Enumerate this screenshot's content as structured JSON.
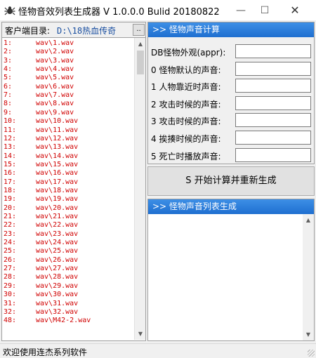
{
  "window": {
    "title": "怪物音效列表生成器 V 1.0.0.0 Bulid 20180822",
    "minimize": "—",
    "maximize": "☐",
    "close": "✕"
  },
  "left": {
    "dir_label": "客户端目录:",
    "dir_value": "D:\\18热血传奇",
    "browse_label": ".."
  },
  "sound_list": [
    {
      "num": "1:",
      "file": "wav\\1.wav"
    },
    {
      "num": "2:",
      "file": "wav\\2.wav"
    },
    {
      "num": "3:",
      "file": "wav\\3.wav"
    },
    {
      "num": "4:",
      "file": "wav\\4.wav"
    },
    {
      "num": "5:",
      "file": "wav\\5.wav"
    },
    {
      "num": "6:",
      "file": "wav\\6.wav"
    },
    {
      "num": "7:",
      "file": "wav\\7.wav"
    },
    {
      "num": "8:",
      "file": "wav\\8.wav"
    },
    {
      "num": "9:",
      "file": "wav\\9.wav"
    },
    {
      "num": "10:",
      "file": "wav\\10.wav"
    },
    {
      "num": "11:",
      "file": "wav\\11.wav"
    },
    {
      "num": "12:",
      "file": "wav\\12.wav"
    },
    {
      "num": "13:",
      "file": "wav\\13.wav"
    },
    {
      "num": "14:",
      "file": "wav\\14.wav"
    },
    {
      "num": "15:",
      "file": "wav\\15.wav"
    },
    {
      "num": "16:",
      "file": "wav\\16.wav"
    },
    {
      "num": "17:",
      "file": "wav\\17.wav"
    },
    {
      "num": "18:",
      "file": "wav\\18.wav"
    },
    {
      "num": "19:",
      "file": "wav\\19.wav"
    },
    {
      "num": "20:",
      "file": "wav\\20.wav"
    },
    {
      "num": "21:",
      "file": "wav\\21.wav"
    },
    {
      "num": "22:",
      "file": "wav\\22.wav"
    },
    {
      "num": "23:",
      "file": "wav\\23.wav"
    },
    {
      "num": "24:",
      "file": "wav\\24.wav"
    },
    {
      "num": "25:",
      "file": "wav\\25.wav"
    },
    {
      "num": "26:",
      "file": "wav\\26.wav"
    },
    {
      "num": "27:",
      "file": "wav\\27.wav"
    },
    {
      "num": "28:",
      "file": "wav\\28.wav"
    },
    {
      "num": "29:",
      "file": "wav\\29.wav"
    },
    {
      "num": "30:",
      "file": "wav\\30.wav"
    },
    {
      "num": "31:",
      "file": "wav\\31.wav"
    },
    {
      "num": "32:",
      "file": "wav\\32.wav"
    },
    {
      "num": "48:",
      "file": "wav\\M42-2.wav"
    }
  ],
  "calc_panel": {
    "header": ">> 怪物声音计算",
    "fields": [
      {
        "label": "DB怪物外观(appr):",
        "value": ""
      },
      {
        "label": "0 怪物默认的声音:",
        "value": ""
      },
      {
        "label": "1 人物靠近时声音:",
        "value": ""
      },
      {
        "label": "2 攻击时候的声音:",
        "value": ""
      },
      {
        "label": "3 攻击时候的声音:",
        "value": ""
      },
      {
        "label": "4 挨揍时候的声音:",
        "value": ""
      },
      {
        "label": "5 死亡时播放声音:",
        "value": ""
      }
    ]
  },
  "generate_button": "S 开始计算并重新生成",
  "list_panel": {
    "header": ">> 怪物声音列表生成"
  },
  "scroll": {
    "up": "▲",
    "down": "▼"
  },
  "status": {
    "text": "欢迎使用连杰系列软件"
  },
  "colors": {
    "list_text": "#d00000",
    "header_bg": "#2a7de1",
    "dir_value": "#1a4fa0"
  }
}
